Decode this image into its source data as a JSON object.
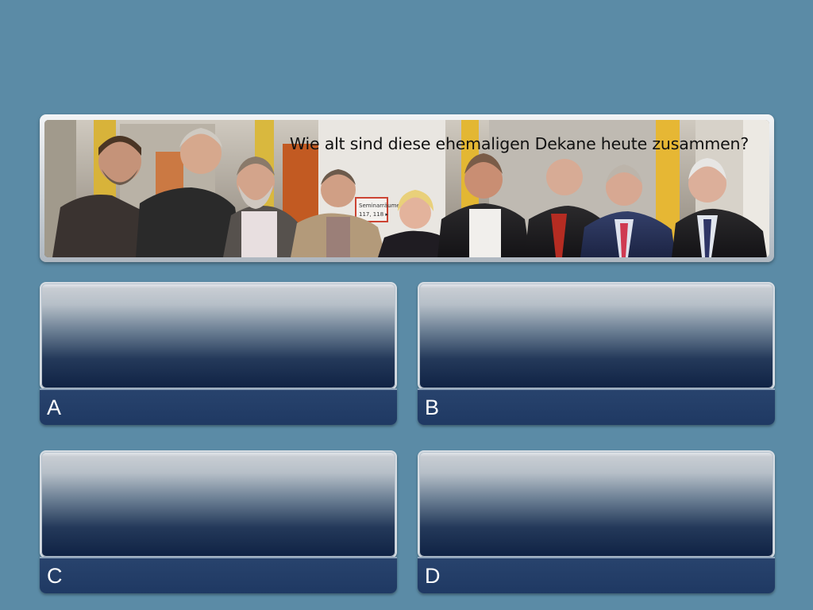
{
  "question": {
    "text": "Wie alt sind diese ehemaligen Dekane heute zusammen?",
    "photo_sign": "Seminarräume",
    "photo_sign_number": "117, 118"
  },
  "answers": [
    {
      "letter": "A",
      "text": ""
    },
    {
      "letter": "B",
      "text": ""
    },
    {
      "letter": "C",
      "text": ""
    },
    {
      "letter": "D",
      "text": ""
    }
  ],
  "colors": {
    "background": "#5b8ba6",
    "answer_bar": "#213b65",
    "answer_text": "#ffffff"
  }
}
